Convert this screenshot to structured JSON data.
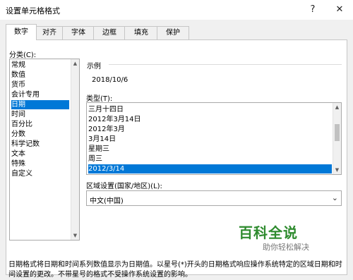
{
  "window": {
    "title": "设置单元格格式",
    "help_symbol": "?",
    "close_symbol": "✕"
  },
  "tabs": [
    {
      "label": "数字",
      "active": true
    },
    {
      "label": "对齐",
      "active": false
    },
    {
      "label": "字体",
      "active": false
    },
    {
      "label": "边框",
      "active": false
    },
    {
      "label": "填充",
      "active": false
    },
    {
      "label": "保护",
      "active": false
    }
  ],
  "category": {
    "label": "分类(C):",
    "items": [
      "常规",
      "数值",
      "货币",
      "会计专用",
      "日期",
      "时间",
      "百分比",
      "分数",
      "科学记数",
      "文本",
      "特殊",
      "自定义"
    ],
    "selected": "日期"
  },
  "sample": {
    "label": "示例",
    "value": "2018/10/6"
  },
  "type": {
    "label": "类型(T):",
    "items": [
      "三月十四日",
      "2012年3月14日",
      "2012年3月",
      "3月14日",
      "星期三",
      "周三",
      "2012/3/14"
    ],
    "selected": "2012/3/14"
  },
  "locale": {
    "label": "区域设置(国家/地区)(L):",
    "value": "中文(中国)"
  },
  "description": {
    "line1": "日期格式将日期和时间系列数值显示为日期值。以星号(*)开头的日期格式响应操作系统特定的区域日期和时",
    "line2": "间设置的更改。不带星号的格式不受操作系统设置的影响。"
  },
  "watermark": {
    "main": "百科全说",
    "sub": "助你轻松解决"
  },
  "colors": {
    "selection": "#0078d7",
    "watermark": "#2e8b2e"
  }
}
